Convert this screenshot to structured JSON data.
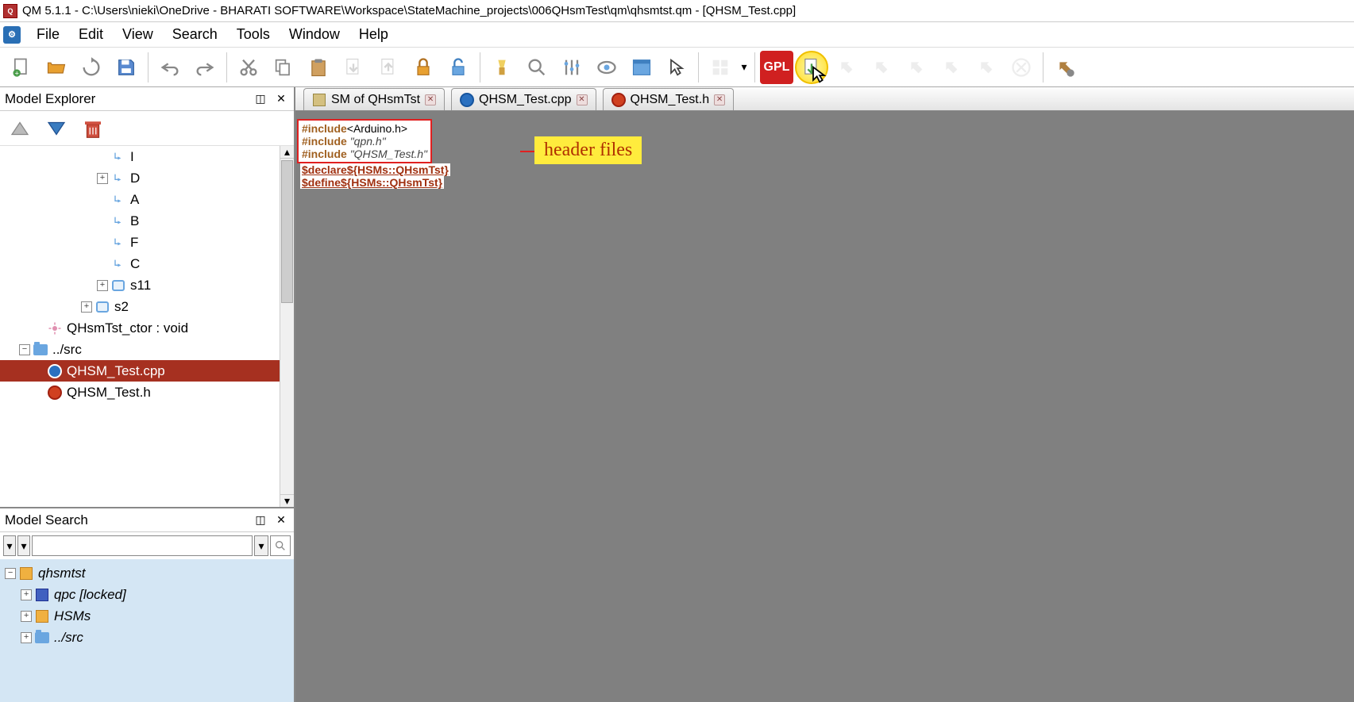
{
  "window": {
    "title": "QM 5.1.1 - C:\\Users\\nieki\\OneDrive - BHARATI SOFTWARE\\Workspace\\StateMachine_projects\\006QHsmTest\\qm\\qhsmtst.qm - [QHSM_Test.cpp]"
  },
  "menu": {
    "file": "File",
    "edit": "Edit",
    "view": "View",
    "search": "Search",
    "tools": "Tools",
    "window": "Window",
    "help": "Help"
  },
  "panels": {
    "explorer_title": "Model Explorer",
    "search_title": "Model Search"
  },
  "tree": {
    "items": [
      {
        "label": "I",
        "indent": 140,
        "icon": "arrow"
      },
      {
        "label": "D",
        "indent": 140,
        "icon": "arrow",
        "expander": "+",
        "exp_indent": 122
      },
      {
        "label": "A",
        "indent": 140,
        "icon": "arrow"
      },
      {
        "label": "B",
        "indent": 140,
        "icon": "arrow"
      },
      {
        "label": "F",
        "indent": 140,
        "icon": "arrow"
      },
      {
        "label": "C",
        "indent": 140,
        "icon": "arrow"
      },
      {
        "label": "s11",
        "indent": 140,
        "icon": "state",
        "expander": "+",
        "exp_indent": 122
      },
      {
        "label": "s2",
        "indent": 120,
        "icon": "state",
        "expander": "+",
        "exp_indent": 102
      },
      {
        "label": "QHsmTst_ctor : void",
        "indent": 60,
        "icon": "gear-pink"
      },
      {
        "label": "../src",
        "indent": 40,
        "icon": "folder",
        "expander": "−",
        "exp_indent": 24
      },
      {
        "label": "QHSM_Test.cpp",
        "indent": 60,
        "icon": "cpp",
        "selected": true
      },
      {
        "label": "QHSM_Test.h",
        "indent": 60,
        "icon": "h"
      }
    ]
  },
  "search_tree": {
    "items": [
      {
        "label": "qhsmtst",
        "indent": 20,
        "icon": "pkg",
        "expander": "−",
        "exp_indent": 4
      },
      {
        "label": "qpc [locked]",
        "indent": 40,
        "icon": "pkg-blue",
        "expander": "+",
        "exp_indent": 24
      },
      {
        "label": "HSMs",
        "indent": 40,
        "icon": "pkg",
        "expander": "+",
        "exp_indent": 24
      },
      {
        "label": "../src",
        "indent": 40,
        "icon": "folder",
        "expander": "+",
        "exp_indent": 24
      }
    ]
  },
  "tabs": [
    {
      "label": "SM of QHsmTst",
      "icon": "sm"
    },
    {
      "label": "QHSM_Test.cpp",
      "icon": "cpp"
    },
    {
      "label": "QHSM_Test.h",
      "icon": "h"
    }
  ],
  "code": {
    "line1_kw": "#include",
    "line1_rest": "<Arduino.h>",
    "line2_kw": "#include",
    "line2_str": "\"qpn.h\"",
    "line3_kw": "#include",
    "line3_str": "\"QHSM_Test.h\"",
    "line4": "$declare${HSMs::QHsmTst}",
    "line5": "$define${HSMs::QHsmTst}"
  },
  "annotation": {
    "label": "header files"
  },
  "toolbar": {
    "gpl": "GPL"
  }
}
